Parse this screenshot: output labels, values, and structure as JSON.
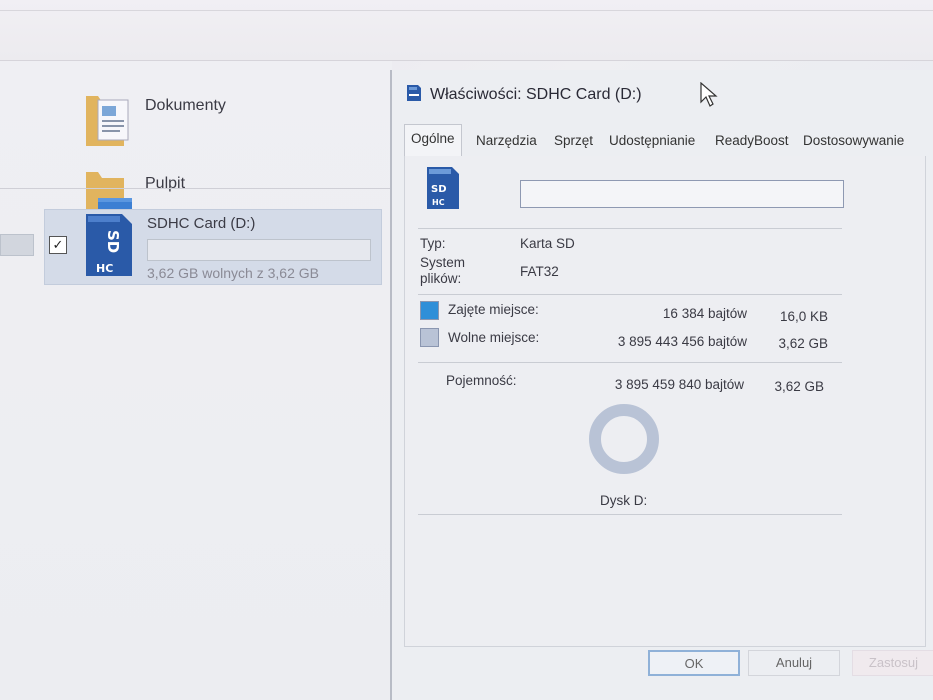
{
  "explorer": {
    "folders": [
      {
        "name": "Dokumenty",
        "icon": "documents-folder-icon"
      },
      {
        "name": "Pulpit",
        "icon": "desktop-folder-icon"
      }
    ],
    "drive": {
      "name": "SDHC Card (D:)",
      "free_text": "3,62 GB wolnych z 3,62 GB",
      "used_fraction": 0.0,
      "checked": true,
      "icon": "sdhc-card-icon"
    }
  },
  "dialog": {
    "title": "Właściwości: SDHC Card (D:)",
    "tabs": [
      "Ogólne",
      "Narzędzia",
      "Sprzęt",
      "Udostępnianie",
      "ReadyBoost",
      "Dostosowywanie"
    ],
    "active_tab": "Ogólne",
    "label_value": "",
    "type_label": "Typ:",
    "type_value": "Karta SD",
    "fs_label_1": "System",
    "fs_label_2": "plików:",
    "fs_value": "FAT32",
    "used_label": "Zajęte miejsce:",
    "used_bytes": "16 384 bajtów",
    "used_size": "16,0 KB",
    "free_label": "Wolne miejsce:",
    "free_bytes": "3 895 443 456 bajtów",
    "free_size": "3,62 GB",
    "capacity_label": "Pojemność:",
    "capacity_bytes": "3 895 459 840 bajtów",
    "capacity_size": "3,62 GB",
    "disk_label": "Dysk D:",
    "used_fraction": 4.2e-06,
    "buttons": {
      "ok": "OK",
      "cancel": "Anuluj",
      "apply": "Zastosuj"
    },
    "colors": {
      "used": "#2f8fd8",
      "free": "#b9c3d6"
    }
  }
}
